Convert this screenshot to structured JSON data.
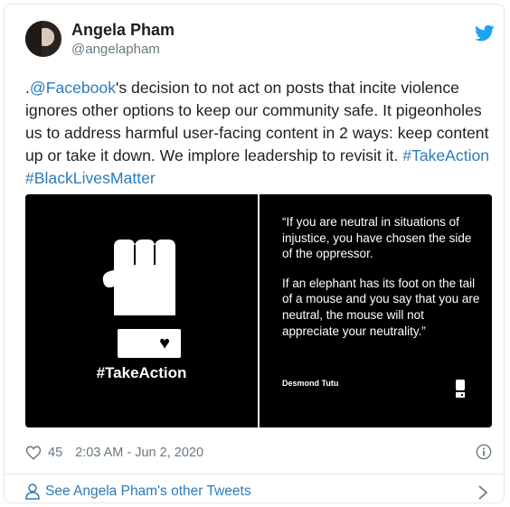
{
  "user": {
    "name": "Angela Pham",
    "handle": "@angelapham"
  },
  "tweet": {
    "prefix": ".",
    "mention": "@Facebook",
    "body": "'s decision to not act on posts that incite violence ignores other options to keep our community safe. It pigeonholes us to address harmful user-facing content in 2 ways: keep content up or take it down. We implore leadership to revisit it. ",
    "hashtag1": "#TakeAction",
    "space": " ",
    "hashtag2": "#BlackLivesMatter"
  },
  "media": {
    "image_hashtag": "#TakeAction",
    "quote_line1": "“If you are neutral in situations of injustice, you have chosen the side of the oppressor.",
    "quote_line2": "If an elephant has its foot on the tail of a mouse and you say that you are neutral, the mouse will not appreciate your neutrality.”",
    "author": "Desmond Tutu"
  },
  "meta": {
    "likes": "45",
    "timestamp": "2:03 AM - Jun 2, 2020"
  },
  "footer": {
    "link_text": "See Angela Pham's other Tweets"
  },
  "icons": {
    "brand": "twitter-bird-icon",
    "like": "heart-outline-icon",
    "info": "info-icon",
    "person": "person-icon",
    "chevron": "chevron-right-icon"
  },
  "colors": {
    "brand": "#1da1f2",
    "link": "#2b7bb9",
    "secondary_text": "#697882",
    "border": "#e1e8ed"
  }
}
